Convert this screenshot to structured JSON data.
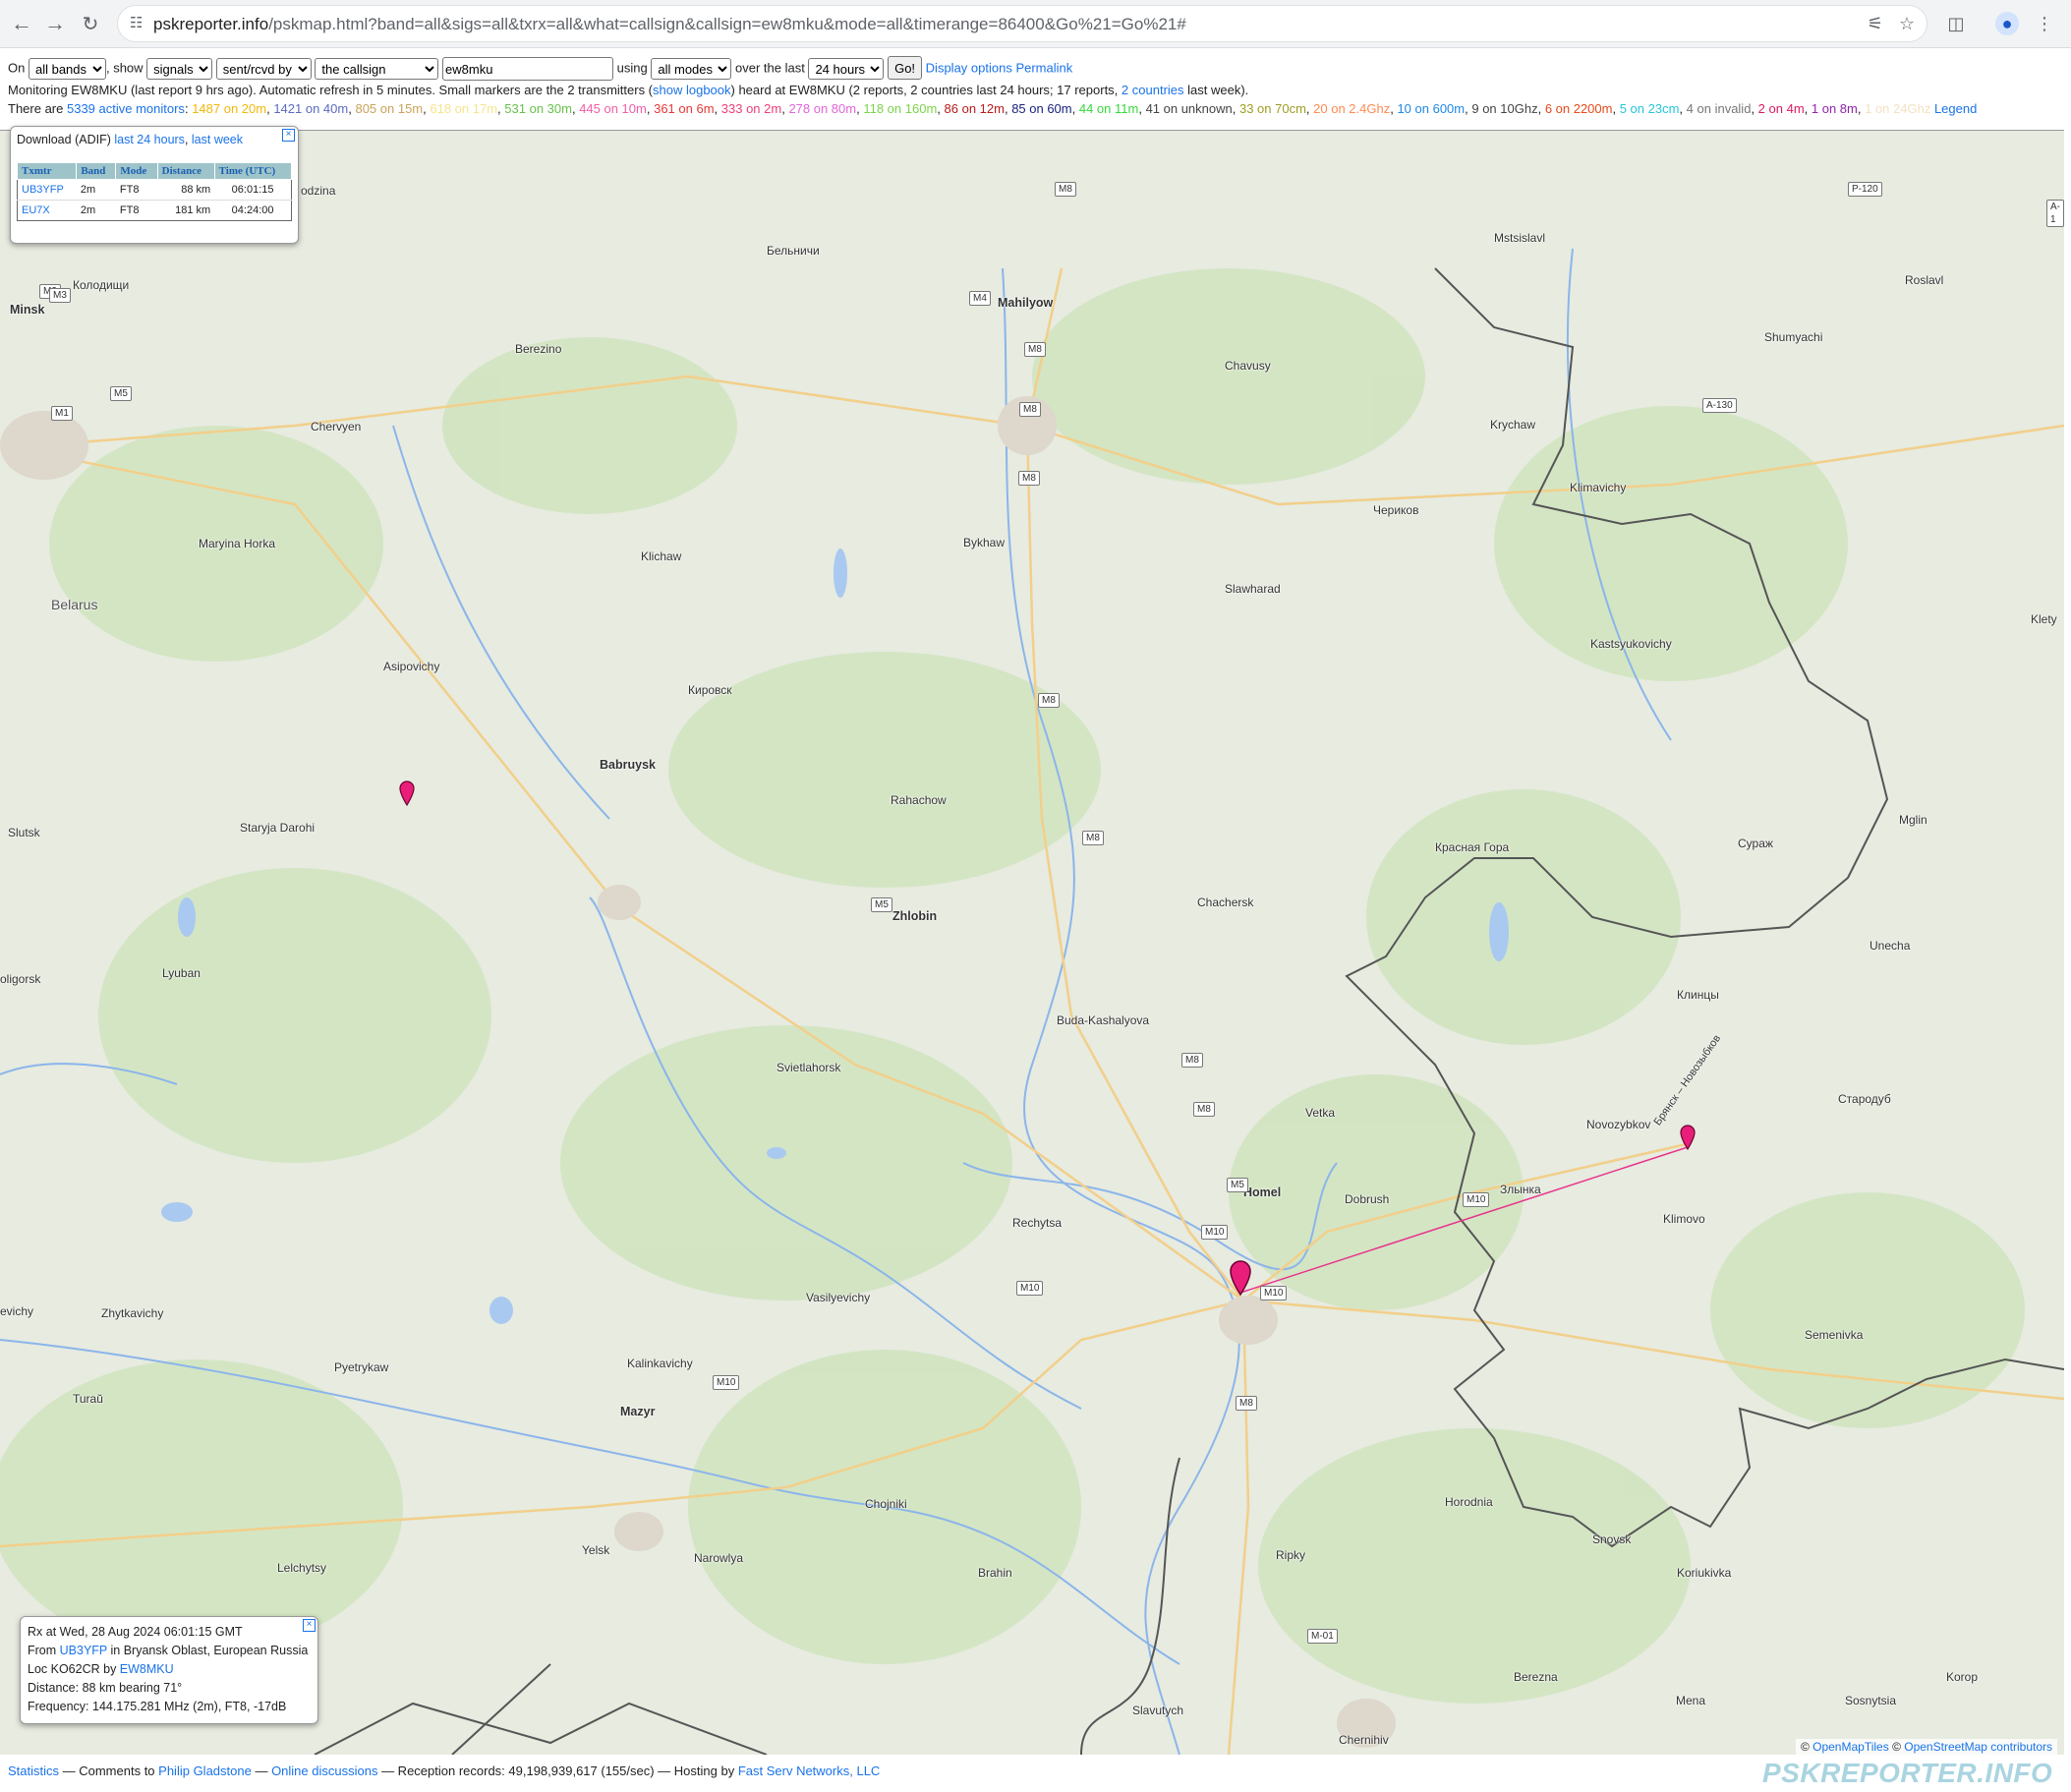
{
  "browser": {
    "url_host": "pskreporter.info",
    "url_path": "/pskmap.html?band=all&sigs=all&txrx=all&what=callsign&callsign=ew8mku&mode=all&timerange=86400&Go%21=Go%21#",
    "icons": [
      "back-icon",
      "forward-icon",
      "reload-icon",
      "site-info-icon",
      "translate-icon",
      "bookmark-star-icon",
      "extensions-icon",
      "profile-icon",
      "menu-icon"
    ]
  },
  "controls": {
    "on_label": "On",
    "band_value": "all bands",
    "show_label": ", show",
    "sigs_value": "signals",
    "txrx_value": "sent/rcvd by",
    "what_value": "the callsign",
    "callsign_value": "ew8mku",
    "using_label": "using",
    "mode_value": "all modes",
    "over_label": "over the last",
    "timerange_value": "24 hours",
    "go_label": "Go!",
    "display_options": "Display options",
    "permalink": "Permalink"
  },
  "monitoring": {
    "prefix": "Monitoring EW8MKU (last report 9 hrs ago). Automatic refresh in 5 minutes. Small markers are the 2 transmitters (",
    "show_logbook": "show logbook",
    "middle": ") heard at EW8MKU (2 reports, 2 countries last 24 hours; 17 reports, ",
    "countries_link": "2 countries",
    "suffix": " last week)."
  },
  "active": {
    "prefix": "There are ",
    "monitors_link": "5339 active monitors",
    "colon": ":",
    "legend": "Legend",
    "bands": [
      {
        "text": "1487 on 20m",
        "color": "#f2b90c"
      },
      {
        "text": "1421 on 40m",
        "color": "#5c6bc0"
      },
      {
        "text": "805 on 15m",
        "color": "#c9a25a"
      },
      {
        "text": "618 on 17m",
        "color": "#f6e58d"
      },
      {
        "text": "531 on 30m",
        "color": "#66c24a"
      },
      {
        "text": "445 on 10m",
        "color": "#ef5fa7"
      },
      {
        "text": "361 on 6m",
        "color": "#e53935"
      },
      {
        "text": "333 on 2m",
        "color": "#ec407a"
      },
      {
        "text": "278 on 80m",
        "color": "#e066d8"
      },
      {
        "text": "118 on 160m",
        "color": "#7bd44a"
      },
      {
        "text": "86 on 12m",
        "color": "#b71c1c"
      },
      {
        "text": "85 on 60m",
        "color": "#1a237e"
      },
      {
        "text": "44 on 11m",
        "color": "#36d93a"
      },
      {
        "text": "41 on unknown",
        "color": "#444444"
      },
      {
        "text": "33 on 70cm",
        "color": "#9e9d24"
      },
      {
        "text": "20 on 2.4Ghz",
        "color": "#ff8a50"
      },
      {
        "text": "10 on 600m",
        "color": "#1e88e5"
      },
      {
        "text": "9 on 10Ghz",
        "color": "#444444"
      },
      {
        "text": "6 on 2200m",
        "color": "#e64a19"
      },
      {
        "text": "5 on 23cm",
        "color": "#26c6da"
      },
      {
        "text": "4 on invalid",
        "color": "#777777"
      },
      {
        "text": "2 on 4m",
        "color": "#d81b60"
      },
      {
        "text": "1 on 8m",
        "color": "#8e24aa"
      },
      {
        "text": "1 on 24Ghz",
        "color": "#f3e1c2"
      }
    ]
  },
  "adif": {
    "label": "Download (ADIF)",
    "link_24h": "last 24 hours",
    "link_week": "last week",
    "close": "☒",
    "headers": [
      "Txmtr",
      "Band",
      "Mode",
      "Distance",
      "Time (UTC)"
    ],
    "rows": [
      {
        "txmtr": "UB3YFP",
        "band": "2m",
        "mode": "FT8",
        "distance": "88 km",
        "time": "06:01:15"
      },
      {
        "txmtr": "EU7X",
        "band": "2m",
        "mode": "FT8",
        "distance": "181 km",
        "time": "04:24:00"
      }
    ]
  },
  "rx_popup": {
    "line1": "Rx at Wed, 28 Aug 2024 06:01:15 GMT",
    "from_label": "From ",
    "from_call": "UB3YFP",
    "from_suffix": " in Bryansk Oblast, European Russia",
    "loc_label": "Loc KO62CR by ",
    "loc_call": "EW8MKU",
    "distance": "Distance: 88 km bearing 71°",
    "frequency": "Frequency: 144.175.281 MHz (2m), FT8, -17dB",
    "close": "☒"
  },
  "map": {
    "places": [
      {
        "name": "Mahilyow",
        "big": true
      },
      {
        "name": "Minsk",
        "big": true
      },
      {
        "name": "Babruysk",
        "big": true
      },
      {
        "name": "Zhlobin",
        "big": true
      },
      {
        "name": "Homel",
        "big": true
      },
      {
        "name": "Mazyr",
        "big": true
      },
      {
        "name": "Belarus",
        "country": true
      },
      {
        "name": "Бельничи"
      },
      {
        "name": "Mstsislavl"
      },
      {
        "name": "Roslavl"
      },
      {
        "name": "Berezino"
      },
      {
        "name": "Chervyen"
      },
      {
        "name": "Chavusy"
      },
      {
        "name": "Shumyachi"
      },
      {
        "name": "Krychaw"
      },
      {
        "name": "Klimavichy"
      },
      {
        "name": "Чериков"
      },
      {
        "name": "Maryina Horka"
      },
      {
        "name": "Klichaw"
      },
      {
        "name": "Bykhaw"
      },
      {
        "name": "Slawharad"
      },
      {
        "name": "Kastsyukovichy"
      },
      {
        "name": "Asipovichy"
      },
      {
        "name": "Кировск"
      },
      {
        "name": "Slutsk"
      },
      {
        "name": "Staryja Darohi"
      },
      {
        "name": "Rahachow"
      },
      {
        "name": "Красная Гора"
      },
      {
        "name": "Сураж"
      },
      {
        "name": "Mglin"
      },
      {
        "name": "Chachersk"
      },
      {
        "name": "Unecha"
      },
      {
        "name": "Lyuban"
      },
      {
        "name": "Buda-Kashalyova"
      },
      {
        "name": "Клинцы"
      },
      {
        "name": "Svietlahorsk"
      },
      {
        "name": "Vetka"
      },
      {
        "name": "Novozybkov"
      },
      {
        "name": "Стародуб"
      },
      {
        "name": "Dobrush"
      },
      {
        "name": "Злынка"
      },
      {
        "name": "Rechytsa"
      },
      {
        "name": "Klimovo"
      },
      {
        "name": "Vasilyevichy"
      },
      {
        "name": "Zhytkavichy"
      },
      {
        "name": "Pyetrykaw"
      },
      {
        "name": "Kalinkavichy"
      },
      {
        "name": "Semenivka"
      },
      {
        "name": "Turaŭ"
      },
      {
        "name": "Horodnia"
      },
      {
        "name": "Chojniki"
      },
      {
        "name": "Snovsk"
      },
      {
        "name": "Yelsk"
      },
      {
        "name": "Narowlya"
      },
      {
        "name": "Lelchytsy"
      },
      {
        "name": "Brahin"
      },
      {
        "name": "Ripky"
      },
      {
        "name": "Koriukivka"
      },
      {
        "name": "Berezna"
      },
      {
        "name": "Slavutych"
      },
      {
        "name": "Chernihiv"
      },
      {
        "name": "Mena"
      },
      {
        "name": "Sosnytsia"
      },
      {
        "name": "Korop"
      },
      {
        "name": "Колодищи"
      },
      {
        "name": "odzina"
      },
      {
        "name": "oligorsk"
      },
      {
        "name": "evichy"
      },
      {
        "name": "Klety"
      },
      {
        "name": "Брянск – Новозыбков"
      }
    ],
    "roads": [
      "M8",
      "M4",
      "M3",
      "M5",
      "M1",
      "M10",
      "A-130",
      "P-120",
      "A-1",
      "M-01"
    ]
  },
  "attribution": {
    "sep": "© ",
    "omt": "OpenMapTiles",
    "osm": "OpenStreetMap contributors"
  },
  "footer": {
    "statistics": "Statistics",
    "comments": " — Comments to ",
    "author": "Philip Gladstone",
    "dash": " — ",
    "discussions": "Online discussions",
    "records": " — Reception records: 49,198,939,617 (155/sec) — Hosting by ",
    "host": "Fast Serv Networks, LLC",
    "logo": "PSKREPORTER.INFO"
  }
}
